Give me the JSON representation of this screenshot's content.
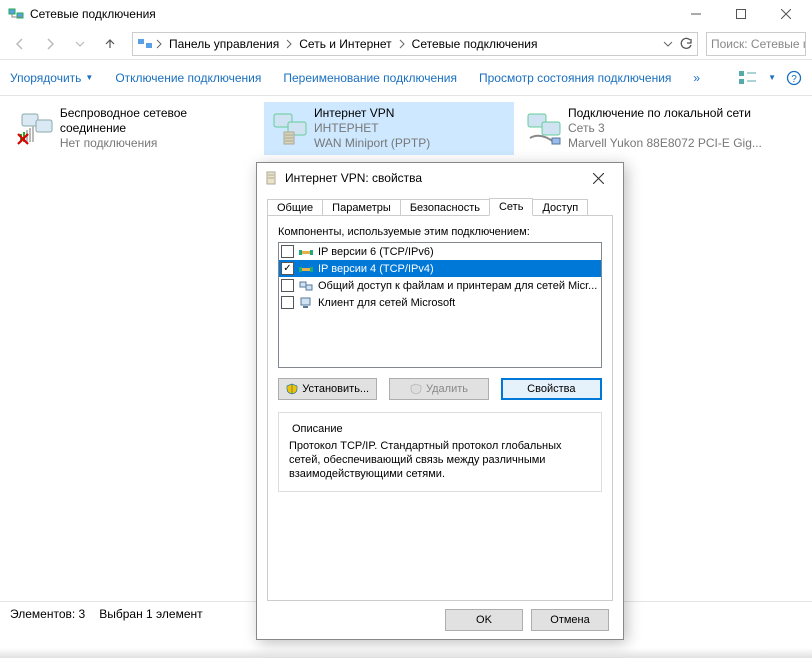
{
  "window": {
    "title": "Сетевые подключения"
  },
  "breadcrumb": {
    "items": [
      "Панель управления",
      "Сеть и Интернет",
      "Сетевые подключения"
    ]
  },
  "search": {
    "placeholder": "Поиск: Сетевые п"
  },
  "commands": {
    "organize": "Упорядочить",
    "disable": "Отключение подключения",
    "rename": "Переименование подключения",
    "viewStatus": "Просмотр состояния подключения"
  },
  "connections": [
    {
      "name": "Беспроводное сетевое соединение",
      "status": "Нет подключения",
      "detail": "",
      "selected": false,
      "iconType": "wifi-disabled"
    },
    {
      "name": "Интернет  VPN",
      "status": "ИНТЕРНЕТ",
      "detail": "WAN Miniport (PPTP)",
      "selected": true,
      "iconType": "vpn"
    },
    {
      "name": "Подключение по локальной сети",
      "status": "Сеть 3",
      "detail": "Marvell Yukon 88E8072 PCI-E Gig...",
      "selected": false,
      "iconType": "ethernet"
    }
  ],
  "statusbar": {
    "count": "Элементов: 3",
    "selection": "Выбран 1 элемент"
  },
  "dialog": {
    "title": "Интернет  VPN: свойства",
    "tabs": [
      "Общие",
      "Параметры",
      "Безопасность",
      "Сеть",
      "Доступ"
    ],
    "activeTab": "Сеть",
    "componentsLabel": "Компоненты, используемые этим подключением:",
    "components": [
      {
        "label": "IP версии 6 (TCP/IPv6)",
        "checked": false,
        "selected": false
      },
      {
        "label": "IP версии 4 (TCP/IPv4)",
        "checked": true,
        "selected": true
      },
      {
        "label": "Общий доступ к файлам и принтерам для сетей Micr...",
        "checked": false,
        "selected": false
      },
      {
        "label": "Клиент для сетей Microsoft",
        "checked": false,
        "selected": false
      }
    ],
    "buttons": {
      "install": "Установить...",
      "uninstall": "Удалить",
      "properties": "Свойства"
    },
    "descriptionLabel": "Описание",
    "description": "Протокол TCP/IP. Стандартный протокол глобальных сетей, обеспечивающий связь между различными взаимодействующими сетями.",
    "ok": "OK",
    "cancel": "Отмена"
  }
}
